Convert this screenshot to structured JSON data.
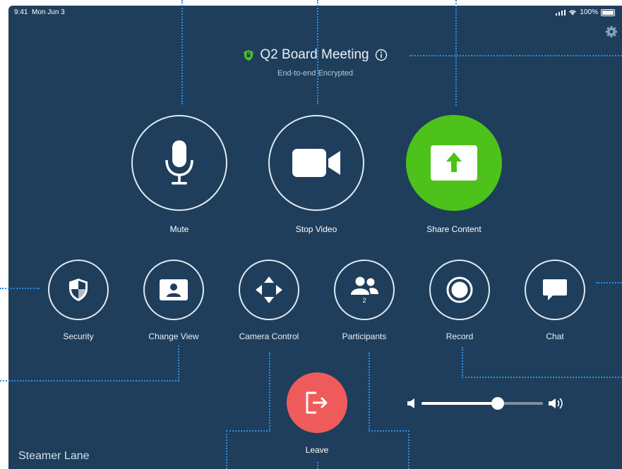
{
  "status": {
    "time": "9:41",
    "date": "Mon Jun 3",
    "battery": "100%"
  },
  "meeting": {
    "title": "Q2 Board Meeting",
    "encryption": "End-to-end Encrypted",
    "room": "Steamer Lane"
  },
  "main_controls": [
    {
      "label": "Mute",
      "icon": "microphone-icon"
    },
    {
      "label": "Stop Video",
      "icon": "video-camera-icon"
    },
    {
      "label": "Share Content",
      "icon": "share-screen-icon"
    }
  ],
  "secondary_controls": [
    {
      "label": "Security",
      "icon": "shield-icon"
    },
    {
      "label": "Change View",
      "icon": "person-card-icon"
    },
    {
      "label": "Camera Control",
      "icon": "arrows-icon"
    },
    {
      "label": "Participants",
      "icon": "people-icon",
      "count": "2"
    },
    {
      "label": "Record",
      "icon": "record-icon"
    },
    {
      "label": "Chat",
      "icon": "chat-bubble-icon"
    }
  ],
  "leave": {
    "label": "Leave",
    "icon": "exit-icon"
  },
  "volume": {
    "level": 0.63
  },
  "colors": {
    "background": "#1f3e5c",
    "share": "#4cc21a",
    "leave": "#ef5b5b",
    "shield": "#4cc21a",
    "callout": "#2b8fe5"
  }
}
